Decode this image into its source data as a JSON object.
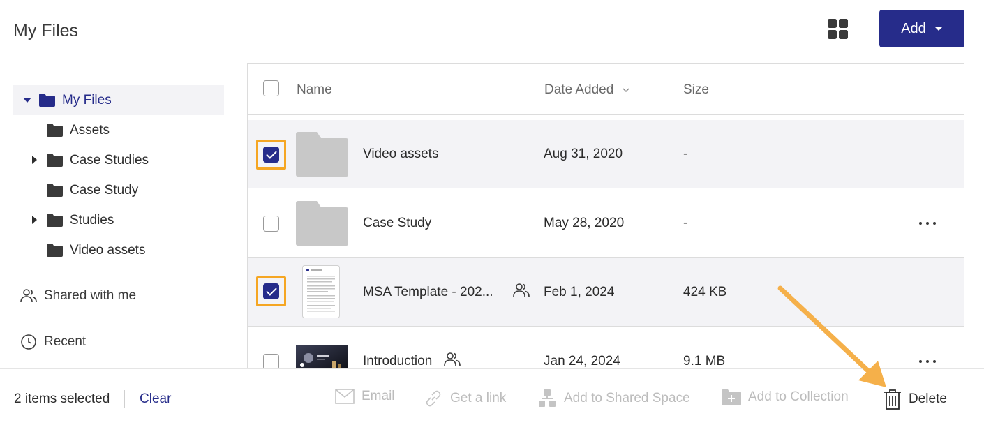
{
  "page": {
    "title": "My Files"
  },
  "toolbar": {
    "add_label": "Add"
  },
  "sidebar": {
    "tree": [
      {
        "label": "My Files",
        "expanded": true,
        "active": true
      },
      {
        "label": "Assets"
      },
      {
        "label": "Case Studies",
        "has_children": true
      },
      {
        "label": "Case Study"
      },
      {
        "label": "Studies",
        "has_children": true
      },
      {
        "label": "Video assets"
      }
    ],
    "shared_label": "Shared with me",
    "recent_label": "Recent"
  },
  "table": {
    "headers": {
      "name": "Name",
      "date": "Date Added",
      "size": "Size"
    },
    "rows": [
      {
        "name": "Video assets",
        "date": "Aug 31, 2020",
        "size": "-",
        "type": "folder",
        "selected": true
      },
      {
        "name": "Case Study",
        "date": "May 28, 2020",
        "size": "-",
        "type": "folder",
        "selected": false
      },
      {
        "name": "MSA Template - 202...",
        "date": "Feb 1, 2024",
        "size": "424 KB",
        "type": "document",
        "shared": true,
        "selected": true
      },
      {
        "name": "Introduction",
        "date": "Jan 24, 2024",
        "size": "9.1 MB",
        "type": "video",
        "shared": true,
        "selected": false
      }
    ]
  },
  "footer": {
    "selected_text": "2 items selected",
    "clear_label": "Clear",
    "actions": {
      "email": "Email",
      "link": "Get a link",
      "shared_space": "Add to Shared Space",
      "collection": "Add to Collection",
      "delete": "Delete"
    }
  },
  "colors": {
    "accent": "#262c8a",
    "highlight": "#f5a623",
    "selected_row": "#f3f3f6"
  }
}
